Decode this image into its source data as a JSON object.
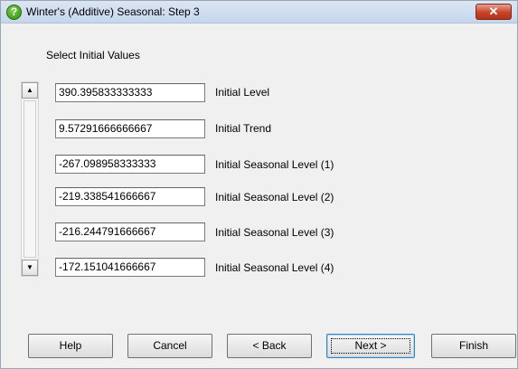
{
  "window": {
    "title": "Winter's (Additive) Seasonal: Step 3",
    "close_label": "✕"
  },
  "section_label": "Select Initial Values",
  "fields": [
    {
      "value": "390.395833333333",
      "label": "Initial Level"
    },
    {
      "value": "9.57291666666667",
      "label": "Initial Trend"
    },
    {
      "value": "-267.098958333333",
      "label": "Initial Seasonal Level (1)"
    },
    {
      "value": "-219.338541666667",
      "label": "Initial Seasonal Level (2)"
    },
    {
      "value": "-216.244791666667",
      "label": "Initial Seasonal Level (3)"
    },
    {
      "value": "-172.151041666667",
      "label": "Initial Seasonal Level (4)"
    }
  ],
  "scrollbar": {
    "up_glyph": "▲",
    "down_glyph": "▼"
  },
  "buttons": {
    "help": "Help",
    "cancel": "Cancel",
    "back": "< Back",
    "next": "Next >",
    "finish": "Finish"
  },
  "icons": {
    "title_icon": "help-question-icon",
    "close_icon": "close-icon"
  },
  "colors": {
    "title_icon_green": "#3a9a1c",
    "close_red": "#c7432a"
  }
}
